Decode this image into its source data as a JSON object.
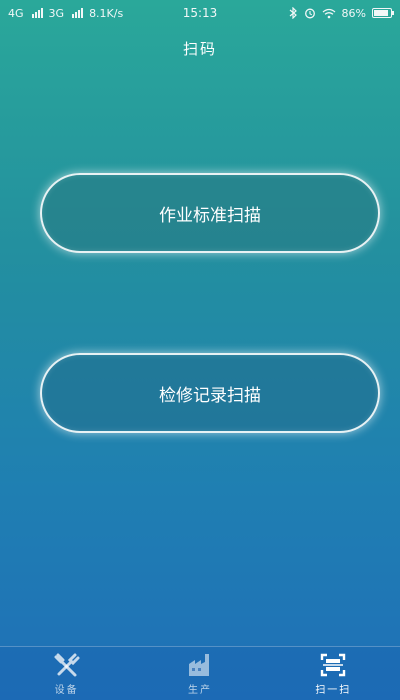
{
  "status_bar": {
    "network_1": "4G",
    "network_2": "3G",
    "speed": "8.1K/s",
    "time": "15:13",
    "battery": "86%",
    "battery_level": 0.86
  },
  "header": {
    "title": "扫码"
  },
  "buttons": {
    "standard_scan": "作业标准扫描",
    "repair_scan": "检修记录扫描"
  },
  "nav": {
    "items": [
      {
        "label": "设备",
        "icon": "tools-icon",
        "active": false
      },
      {
        "label": "生产",
        "icon": "factory-icon",
        "active": false
      },
      {
        "label": "扫一扫",
        "icon": "scan-icon",
        "active": true
      }
    ]
  },
  "colors": {
    "gradient_top": "#2aa89a",
    "gradient_bottom": "#1f6fb8"
  }
}
